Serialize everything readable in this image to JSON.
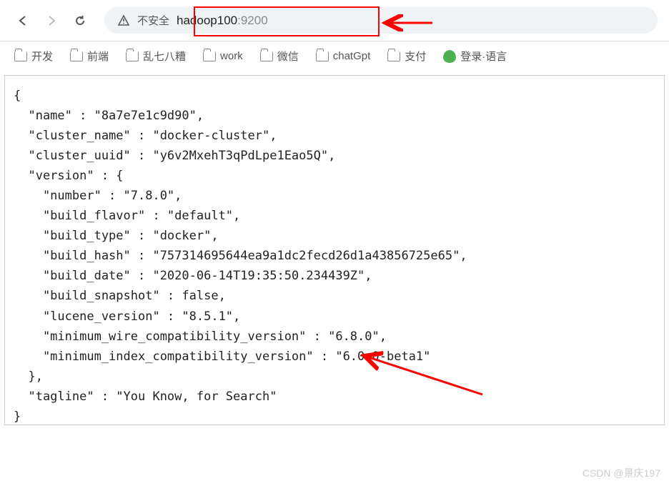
{
  "addressBar": {
    "notSecureLabel": "不安全",
    "host": "hadoop100",
    "port": ":9200"
  },
  "bookmarks": {
    "items": [
      {
        "label": "开发"
      },
      {
        "label": "前端"
      },
      {
        "label": "乱七八糟"
      },
      {
        "label": "work"
      },
      {
        "label": "微信"
      },
      {
        "label": "chatGpt"
      },
      {
        "label": "支付"
      }
    ],
    "extension": "登录·语言"
  },
  "json": {
    "line1": "{",
    "line2": "  \"name\" : \"8a7e7e1c9d90\",",
    "line3": "  \"cluster_name\" : \"docker-cluster\",",
    "line4": "  \"cluster_uuid\" : \"y6v2MxehT3qPdLpe1Eao5Q\",",
    "line5": "  \"version\" : {",
    "line6": "    \"number\" : \"7.8.0\",",
    "line7": "    \"build_flavor\" : \"default\",",
    "line8": "    \"build_type\" : \"docker\",",
    "line9": "    \"build_hash\" : \"757314695644ea9a1dc2fecd26d1a43856725e65\",",
    "line10": "    \"build_date\" : \"2020-06-14T19:35:50.234439Z\",",
    "line11": "    \"build_snapshot\" : false,",
    "line12": "    \"lucene_version\" : \"8.5.1\",",
    "line13": "    \"minimum_wire_compatibility_version\" : \"6.8.0\",",
    "line14": "    \"minimum_index_compatibility_version\" : \"6.0.0-beta1\"",
    "line15": "  },",
    "line16": "  \"tagline\" : \"You Know, for Search\"",
    "line17": "}"
  },
  "watermark": "CSDN @景庆197"
}
